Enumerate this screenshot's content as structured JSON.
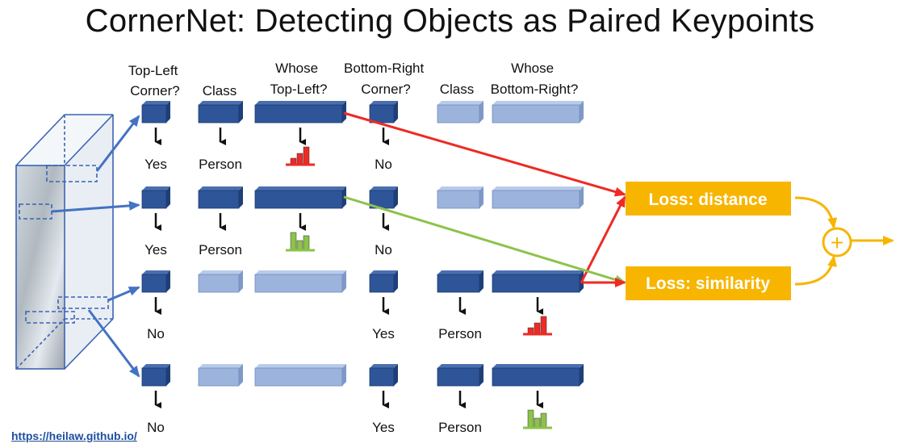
{
  "title": "CornerNet: Detecting Objects as Paired Keypoints",
  "headers": {
    "top_left_corner": [
      "Top-Left",
      "Corner?"
    ],
    "class_1": [
      "Class"
    ],
    "whose_top_left": [
      "Whose",
      "Top-Left?"
    ],
    "bottom_right_corner": [
      "Bottom-Right",
      "Corner?"
    ],
    "class_2": [
      "Class"
    ],
    "whose_bottom_right": [
      "Whose",
      "Bottom-Right?"
    ]
  },
  "rows": [
    {
      "tl": "Yes",
      "class1": "Person",
      "hist1": "red",
      "br": "No",
      "class2": null,
      "hist2": null
    },
    {
      "tl": "Yes",
      "class1": "Person",
      "hist1": "green",
      "br": "No",
      "class2": null,
      "hist2": null
    },
    {
      "tl": "No",
      "class1": null,
      "hist1": null,
      "br": "Yes",
      "class2": "Person",
      "hist2": "red"
    },
    {
      "tl": "No",
      "class1": null,
      "hist1": null,
      "br": "Yes",
      "class2": "Person",
      "hist2": "green"
    }
  ],
  "loss_distance_label": "Loss: distance",
  "loss_similarity_label": "Loss: similarity",
  "plus_symbol": "+",
  "link_text": "https://heilaw.github.io/",
  "colors": {
    "active_block": "#2e5597",
    "inactive_block": "#9cb3dc",
    "loss_box": "#f7b500",
    "distance_arrow": "#ee2a24",
    "similarity_arrow": "#8cc34a",
    "feature_arrow": "#4472c4",
    "output_arrow": "#f7b500"
  }
}
